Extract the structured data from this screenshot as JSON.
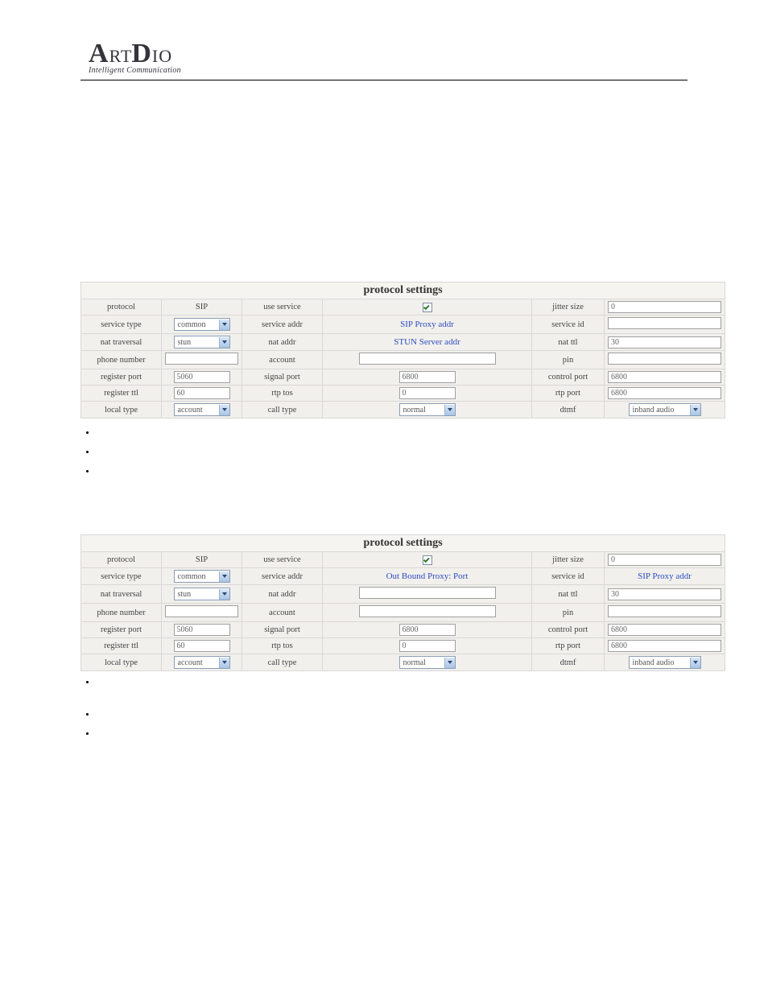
{
  "header": {
    "brand_main": "ArtDio",
    "brand_tagline": "Intelligent Communication"
  },
  "labels": {
    "title": "protocol settings",
    "protocol": "protocol",
    "use_service": "use service",
    "jitter_size": "jitter size",
    "service_type": "service type",
    "service_addr": "service addr",
    "service_id": "service id",
    "nat_traversal": "nat traversal",
    "nat_addr": "nat addr",
    "nat_ttl": "nat ttl",
    "phone_number": "phone number",
    "account": "account",
    "pin": "pin",
    "register_port": "register port",
    "signal_port": "signal port",
    "control_port": "control port",
    "register_ttl": "register ttl",
    "rtp_tos": "rtp tos",
    "rtp_port": "rtp port",
    "local_type": "local type",
    "call_type": "call type",
    "dtmf": "dtmf"
  },
  "tableA": {
    "protocol": "SIP",
    "jitter_size": "0",
    "service_type": "common",
    "service_addr": "SIP Proxy addr",
    "service_id": "",
    "nat_traversal": "stun",
    "nat_addr": "STUN Server addr",
    "nat_ttl": "30",
    "phone_number": "",
    "account": "",
    "pin": "",
    "register_port": "5060",
    "signal_port": "6800",
    "control_port": "6800",
    "register_ttl": "60",
    "rtp_tos": "0",
    "rtp_port": "6800",
    "local_type": "account",
    "call_type": "normal",
    "dtmf": "inband audio"
  },
  "tableB": {
    "protocol": "SIP",
    "jitter_size": "0",
    "service_type": "common",
    "service_addr": "Out Bound Proxy: Port",
    "service_id": "SIP Proxy addr",
    "nat_traversal": "stun",
    "nat_addr": "",
    "nat_ttl": "30",
    "phone_number": "",
    "account": "",
    "pin": "",
    "register_port": "5060",
    "signal_port": "6800",
    "control_port": "6800",
    "register_ttl": "60",
    "rtp_tos": "0",
    "rtp_port": "6800",
    "local_type": "account",
    "call_type": "normal",
    "dtmf": "inband audio"
  }
}
